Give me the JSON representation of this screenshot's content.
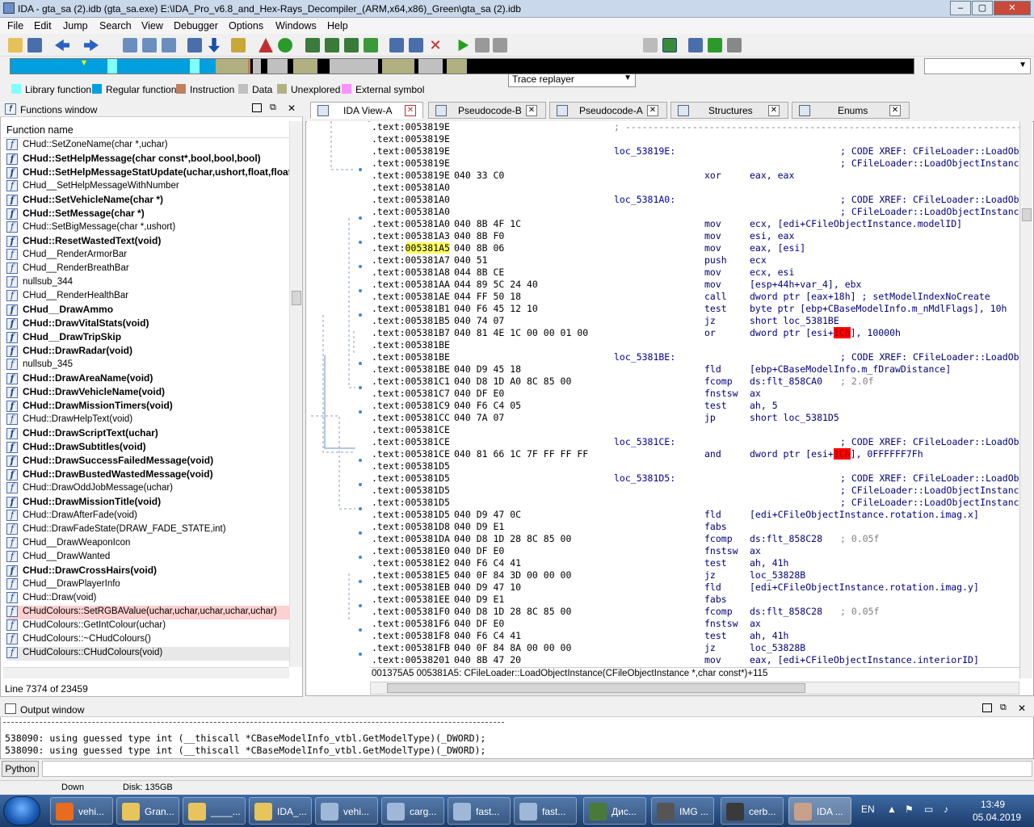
{
  "window": {
    "title": "IDA - gta_sa (2).idb (gta_sa.exe) E:\\IDA_Pro_v6.8_and_Hex-Rays_Decompiler_(ARM,x64,x86)_Green\\gta_sa (2).idb",
    "min": "–",
    "max": "▢",
    "close": "✕"
  },
  "menu": [
    "File",
    "Edit",
    "Jump",
    "Search",
    "View",
    "Debugger",
    "Options",
    "Windows",
    "Help"
  ],
  "toolbar": {
    "debugger_select": "Trace replayer"
  },
  "legend": [
    {
      "label": "Library function",
      "color": "#80ffff"
    },
    {
      "label": "Regular function",
      "color": "#00a0e0"
    },
    {
      "label": "Instruction",
      "color": "#c08060"
    },
    {
      "label": "Data",
      "color": "#c0c0c0"
    },
    {
      "label": "Unexplored",
      "color": "#b0b080"
    },
    {
      "label": "External symbol",
      "color": "#ff90ff"
    }
  ],
  "functions": {
    "title": "Functions window",
    "column": "Function name",
    "rows": [
      {
        "name": "CHud::SetZoneName(char *,uchar)",
        "bold": false
      },
      {
        "name": "CHud::SetHelpMessage(char const*,bool,bool,bool)",
        "bold": true
      },
      {
        "name": "CHud::SetHelpMessageStatUpdate(uchar,ushort,float,float)",
        "bold": true
      },
      {
        "name": "CHud__SetHelpMessageWithNumber",
        "bold": false
      },
      {
        "name": "CHud::SetVehicleName(char *)",
        "bold": true
      },
      {
        "name": "CHud::SetMessage(char *)",
        "bold": true
      },
      {
        "name": "CHud::SetBigMessage(char *,ushort)",
        "bold": false
      },
      {
        "name": "CHud::ResetWastedText(void)",
        "bold": true
      },
      {
        "name": "CHud__RenderArmorBar",
        "bold": false
      },
      {
        "name": "CHud__RenderBreathBar",
        "bold": false
      },
      {
        "name": "nullsub_344",
        "bold": false
      },
      {
        "name": "CHud__RenderHealthBar",
        "bold": false
      },
      {
        "name": "CHud__DrawAmmo",
        "bold": true
      },
      {
        "name": "CHud::DrawVitalStats(void)",
        "bold": true
      },
      {
        "name": "CHud__DrawTripSkip",
        "bold": true
      },
      {
        "name": "CHud::DrawRadar(void)",
        "bold": true
      },
      {
        "name": "nullsub_345",
        "bold": false
      },
      {
        "name": "CHud::DrawAreaName(void)",
        "bold": true
      },
      {
        "name": "CHud::DrawVehicleName(void)",
        "bold": true
      },
      {
        "name": "CHud::DrawMissionTimers(void)",
        "bold": true
      },
      {
        "name": "CHud::DrawHelpText(void)",
        "bold": false
      },
      {
        "name": "CHud::DrawScriptText(uchar)",
        "bold": true
      },
      {
        "name": "CHud::DrawSubtitles(void)",
        "bold": true
      },
      {
        "name": "CHud::DrawSuccessFailedMessage(void)",
        "bold": true
      },
      {
        "name": "CHud::DrawBustedWastedMessage(void)",
        "bold": true
      },
      {
        "name": "CHud::DrawOddJobMessage(uchar)",
        "bold": false
      },
      {
        "name": "CHud::DrawMissionTitle(void)",
        "bold": true
      },
      {
        "name": "CHud::DrawAfterFade(void)",
        "bold": false
      },
      {
        "name": "CHud::DrawFadeState(DRAW_FADE_STATE,int)",
        "bold": false
      },
      {
        "name": "CHud__DrawWeaponIcon",
        "bold": false
      },
      {
        "name": "CHud__DrawWanted",
        "bold": false
      },
      {
        "name": "CHud::DrawCrossHairs(void)",
        "bold": true
      },
      {
        "name": "CHud__DrawPlayerInfo",
        "bold": false
      },
      {
        "name": "CHud::Draw(void)",
        "bold": false
      },
      {
        "name": "CHudColours::SetRGBAValue(uchar,uchar,uchar,uchar,uchar)",
        "bold": false,
        "hl": "#ffd0d0"
      },
      {
        "name": "CHudColours::GetIntColour(uchar)",
        "bold": false
      },
      {
        "name": "CHudColours::~CHudColours()",
        "bold": false
      },
      {
        "name": "CHudColours::CHudColours(void)",
        "bold": false,
        "hl": "#e8e8e8"
      }
    ],
    "linecount": "Line 7374 of 23459"
  },
  "tabs": [
    {
      "label": "IDA View-A",
      "active": true
    },
    {
      "label": "Pseudocode-B",
      "active": false
    },
    {
      "label": "Pseudocode-A",
      "active": false
    },
    {
      "label": "Structures",
      "active": false
    },
    {
      "label": "Enums",
      "active": false
    }
  ],
  "asm": [
    {
      "a": ".text:0053819E",
      "b": "",
      "l": "",
      "m": "",
      "o": "; ---------------------------------------------------------------------------",
      "c": ""
    },
    {
      "a": ".text:0053819E",
      "b": "",
      "l": "",
      "m": "",
      "o": "",
      "c": ""
    },
    {
      "a": ".text:0053819E",
      "b": "",
      "l": "loc_53819E:",
      "m": "",
      "o": "",
      "c": "; CODE XREF: CFileLoader::LoadObjectInstance"
    },
    {
      "a": ".text:0053819E",
      "b": "",
      "l": "",
      "m": "",
      "o": "",
      "c": "; CFileLoader::LoadObjectInstance"
    },
    {
      "a": ".text:0053819E",
      "b": "040 33 C0",
      "l": "",
      "m": "xor",
      "o": "eax, eax",
      "c": ""
    },
    {
      "a": ".text:005381A0",
      "b": "",
      "l": "",
      "m": "",
      "o": "",
      "c": ""
    },
    {
      "a": ".text:005381A0",
      "b": "",
      "l": "loc_5381A0:",
      "m": "",
      "o": "",
      "c": "; CODE XREF: CFileLoader::LoadObjectInstance"
    },
    {
      "a": ".text:005381A0",
      "b": "",
      "l": "",
      "m": "",
      "o": "",
      "c": "; CFileLoader::LoadObjectInstance"
    },
    {
      "a": ".text:005381A0",
      "b": "040 8B 4F 1C",
      "l": "",
      "m": "mov",
      "o": "ecx, [edi+CFileObjectInstance.modelID]",
      "c": ""
    },
    {
      "a": ".text:005381A3",
      "b": "040 8B F0",
      "l": "",
      "m": "mov",
      "o": "esi, eax",
      "c": ""
    },
    {
      "a": ".text:005381A5",
      "b": "040 8B 06",
      "l": "",
      "m": "mov",
      "o": "eax, [esi]",
      "c": "",
      "hl": true
    },
    {
      "a": ".text:005381A7",
      "b": "040 51",
      "l": "",
      "m": "push",
      "o": "ecx",
      "c": ""
    },
    {
      "a": ".text:005381A8",
      "b": "044 8B CE",
      "l": "",
      "m": "mov",
      "o": "ecx, esi",
      "c": ""
    },
    {
      "a": ".text:005381AA",
      "b": "044 89 5C 24 40",
      "l": "",
      "m": "mov",
      "o": "[esp+44h+var_4], ebx",
      "c": ""
    },
    {
      "a": ".text:005381AE",
      "b": "044 FF 50 18",
      "l": "",
      "m": "call",
      "o": "dword ptr [eax+18h] ; setModelIndexNoCreate",
      "c": ""
    },
    {
      "a": ".text:005381B1",
      "b": "040 F6 45 12 10",
      "l": "",
      "m": "test",
      "o": "byte ptr [ebp+CBaseModelInfo.m_nMdlFlags], 10h",
      "c": ""
    },
    {
      "a": ".text:005381B5",
      "b": "040 74 07",
      "l": "",
      "m": "jz",
      "o": "short loc_5381BE",
      "c": ""
    },
    {
      "a": ".text:005381B7",
      "b": "040 81 4E 1C 00 00 01 00",
      "l": "",
      "m": "or",
      "o": "dword ptr [esi+1Ch], 10000h",
      "c": "",
      "red": "1Ch"
    },
    {
      "a": ".text:005381BE",
      "b": "",
      "l": "",
      "m": "",
      "o": "",
      "c": ""
    },
    {
      "a": ".text:005381BE",
      "b": "",
      "l": "loc_5381BE:",
      "m": "",
      "o": "",
      "c": "; CODE XREF: CFileLoader::LoadObjectInstance"
    },
    {
      "a": ".text:005381BE",
      "b": "040 D9 45 18",
      "l": "",
      "m": "fld",
      "o": "[ebp+CBaseModelInfo.m_fDrawDistance]",
      "c": ""
    },
    {
      "a": ".text:005381C1",
      "b": "040 D8 1D A0 8C 85 00",
      "l": "",
      "m": "fcomp",
      "o": "ds:flt_858CA0",
      "c": "; 2.0f"
    },
    {
      "a": ".text:005381C7",
      "b": "040 DF E0",
      "l": "",
      "m": "fnstsw",
      "o": "ax",
      "c": ""
    },
    {
      "a": ".text:005381C9",
      "b": "040 F6 C4 05",
      "l": "",
      "m": "test",
      "o": "ah, 5",
      "c": ""
    },
    {
      "a": ".text:005381CC",
      "b": "040 7A 07",
      "l": "",
      "m": "jp",
      "o": "short loc_5381D5",
      "c": ""
    },
    {
      "a": ".text:005381CE",
      "b": "",
      "l": "",
      "m": "",
      "o": "",
      "c": ""
    },
    {
      "a": ".text:005381CE",
      "b": "",
      "l": "loc_5381CE:",
      "m": "",
      "o": "",
      "c": "; CODE XREF: CFileLoader::LoadObjectInstance"
    },
    {
      "a": ".text:005381CE",
      "b": "040 81 66 1C 7F FF FF FF",
      "l": "",
      "m": "and",
      "o": "dword ptr [esi+1Ch], 0FFFFFF7Fh",
      "c": "",
      "red": "1Ch"
    },
    {
      "a": ".text:005381D5",
      "b": "",
      "l": "",
      "m": "",
      "o": "",
      "c": ""
    },
    {
      "a": ".text:005381D5",
      "b": "",
      "l": "loc_5381D5:",
      "m": "",
      "o": "",
      "c": "; CODE XREF: CFileLoader::LoadObjectInstance"
    },
    {
      "a": ".text:005381D5",
      "b": "",
      "l": "",
      "m": "",
      "o": "",
      "c": "; CFileLoader::LoadObjectInstance"
    },
    {
      "a": ".text:005381D5",
      "b": "",
      "l": "",
      "m": "",
      "o": "",
      "c": "; CFileLoader::LoadObjectInstance"
    },
    {
      "a": ".text:005381D5",
      "b": "040 D9 47 0C",
      "l": "",
      "m": "fld",
      "o": "[edi+CFileObjectInstance.rotation.imag.x]",
      "c": ""
    },
    {
      "a": ".text:005381D8",
      "b": "040 D9 E1",
      "l": "",
      "m": "fabs",
      "o": "",
      "c": ""
    },
    {
      "a": ".text:005381DA",
      "b": "040 D8 1D 28 8C 85 00",
      "l": "",
      "m": "fcomp",
      "o": "ds:flt_858C28",
      "c": "; 0.05f"
    },
    {
      "a": ".text:005381E0",
      "b": "040 DF E0",
      "l": "",
      "m": "fnstsw",
      "o": "ax",
      "c": ""
    },
    {
      "a": ".text:005381E2",
      "b": "040 F6 C4 41",
      "l": "",
      "m": "test",
      "o": "ah, 41h",
      "c": ""
    },
    {
      "a": ".text:005381E5",
      "b": "040 0F 84 3D 00 00 00",
      "l": "",
      "m": "jz",
      "o": "loc_53828B",
      "c": ""
    },
    {
      "a": ".text:005381EB",
      "b": "040 D9 47 10",
      "l": "",
      "m": "fld",
      "o": "[edi+CFileObjectInstance.rotation.imag.y]",
      "c": ""
    },
    {
      "a": ".text:005381EE",
      "b": "040 D9 E1",
      "l": "",
      "m": "fabs",
      "o": "",
      "c": ""
    },
    {
      "a": ".text:005381F0",
      "b": "040 D8 1D 28 8C 85 00",
      "l": "",
      "m": "fcomp",
      "o": "ds:flt_858C28",
      "c": "; 0.05f"
    },
    {
      "a": ".text:005381F6",
      "b": "040 DF E0",
      "l": "",
      "m": "fnstsw",
      "o": "ax",
      "c": ""
    },
    {
      "a": ".text:005381F8",
      "b": "040 F6 C4 41",
      "l": "",
      "m": "test",
      "o": "ah, 41h",
      "c": ""
    },
    {
      "a": ".text:005381FB",
      "b": "040 0F 84 8A 00 00 00",
      "l": "",
      "m": "jz",
      "o": "loc_53828B",
      "c": ""
    },
    {
      "a": ".text:00538201",
      "b": "040 8B 47 20",
      "l": "",
      "m": "mov",
      "o": "eax, [edi+CFileObjectInstance.interiorID]",
      "c": ""
    }
  ],
  "asm_status": "001375A5  005381A5: CFileLoader::LoadObjectInstance(CFileObjectInstance *,char const*)+115",
  "output": {
    "title": "Output window",
    "lines": [
      "538090: using guessed type int (__thiscall *CBaseModelInfo_vtbl.GetModelType)(_DWORD);",
      "538090: using guessed type int (__thiscall *CBaseModelInfo_vtbl.GetModelType)(_DWORD);"
    ],
    "python": "Python"
  },
  "statusbar": {
    "state": "Down",
    "disk": "Disk: 135GB"
  },
  "taskbar": {
    "items": [
      {
        "label": "vehi...",
        "color": "#e86b1f"
      },
      {
        "label": "Gran...",
        "color": "#e8c45c"
      },
      {
        "label": "____...",
        "color": "#e8c45c"
      },
      {
        "label": "IDA_...",
        "color": "#e8c45c"
      },
      {
        "label": "vehi...",
        "color": "#9fb8d8"
      },
      {
        "label": "carg...",
        "color": "#9fb8d8"
      },
      {
        "label": "fast...",
        "color": "#9fb8d8"
      },
      {
        "label": "fast...",
        "color": "#9fb8d8"
      },
      {
        "label": "Дис...",
        "color": "#4a7a3a"
      },
      {
        "label": "IMG ...",
        "color": "#555555"
      },
      {
        "label": "cerb...",
        "color": "#3a3a3a"
      },
      {
        "label": "IDA ...",
        "color": "#c9a08a"
      }
    ],
    "lang": "EN",
    "time": "13:49",
    "date": "05.04.2019"
  }
}
